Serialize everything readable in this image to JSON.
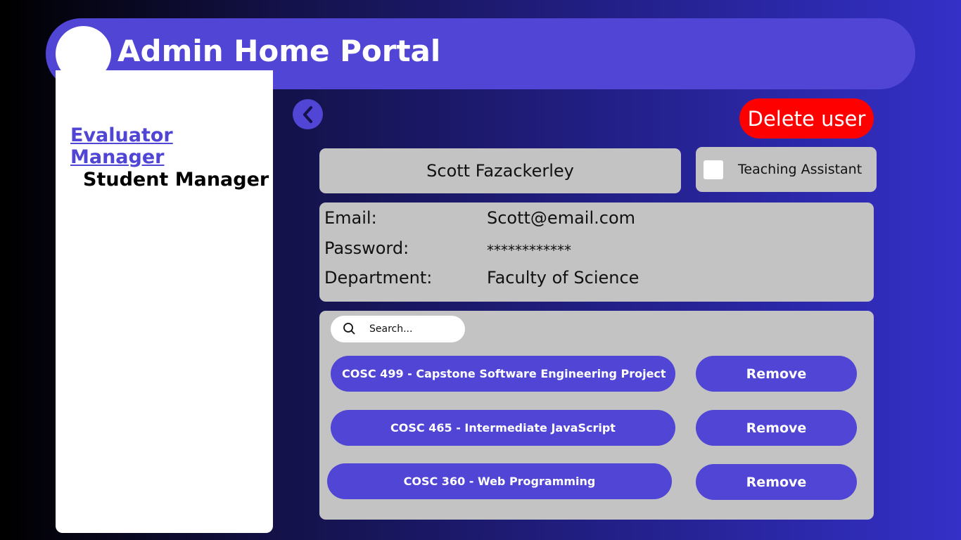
{
  "header": {
    "title": "Admin Home Portal"
  },
  "sidebar": {
    "items": [
      {
        "label": "Evaluator Manager",
        "active": true
      },
      {
        "label": "Student Manager",
        "active": false
      }
    ]
  },
  "toolbar": {
    "back_icon": "chevron-left-icon",
    "delete_label": "Delete user",
    "delete_color": "#ff0000"
  },
  "user": {
    "name": "Scott Fazackerley",
    "teaching_assistant_label": "Teaching Assistant",
    "teaching_assistant_checked": false,
    "fields": [
      {
        "label": "Email:",
        "value": "Scott@email.com"
      },
      {
        "label": "Password:",
        "value": "************"
      },
      {
        "label": "Department:",
        "value": "Faculty of Science"
      }
    ]
  },
  "courses": {
    "search_placeholder": "Search...",
    "remove_label": "Remove",
    "items": [
      {
        "label": "COSC 499 - Capstone Software Engineering Project"
      },
      {
        "label": "COSC 465 -  Intermediate JavaScript"
      },
      {
        "label": "COSC 360 - Web Programming"
      }
    ]
  },
  "colors": {
    "accent": "#5045d4",
    "panel": "#c3c3c3"
  }
}
